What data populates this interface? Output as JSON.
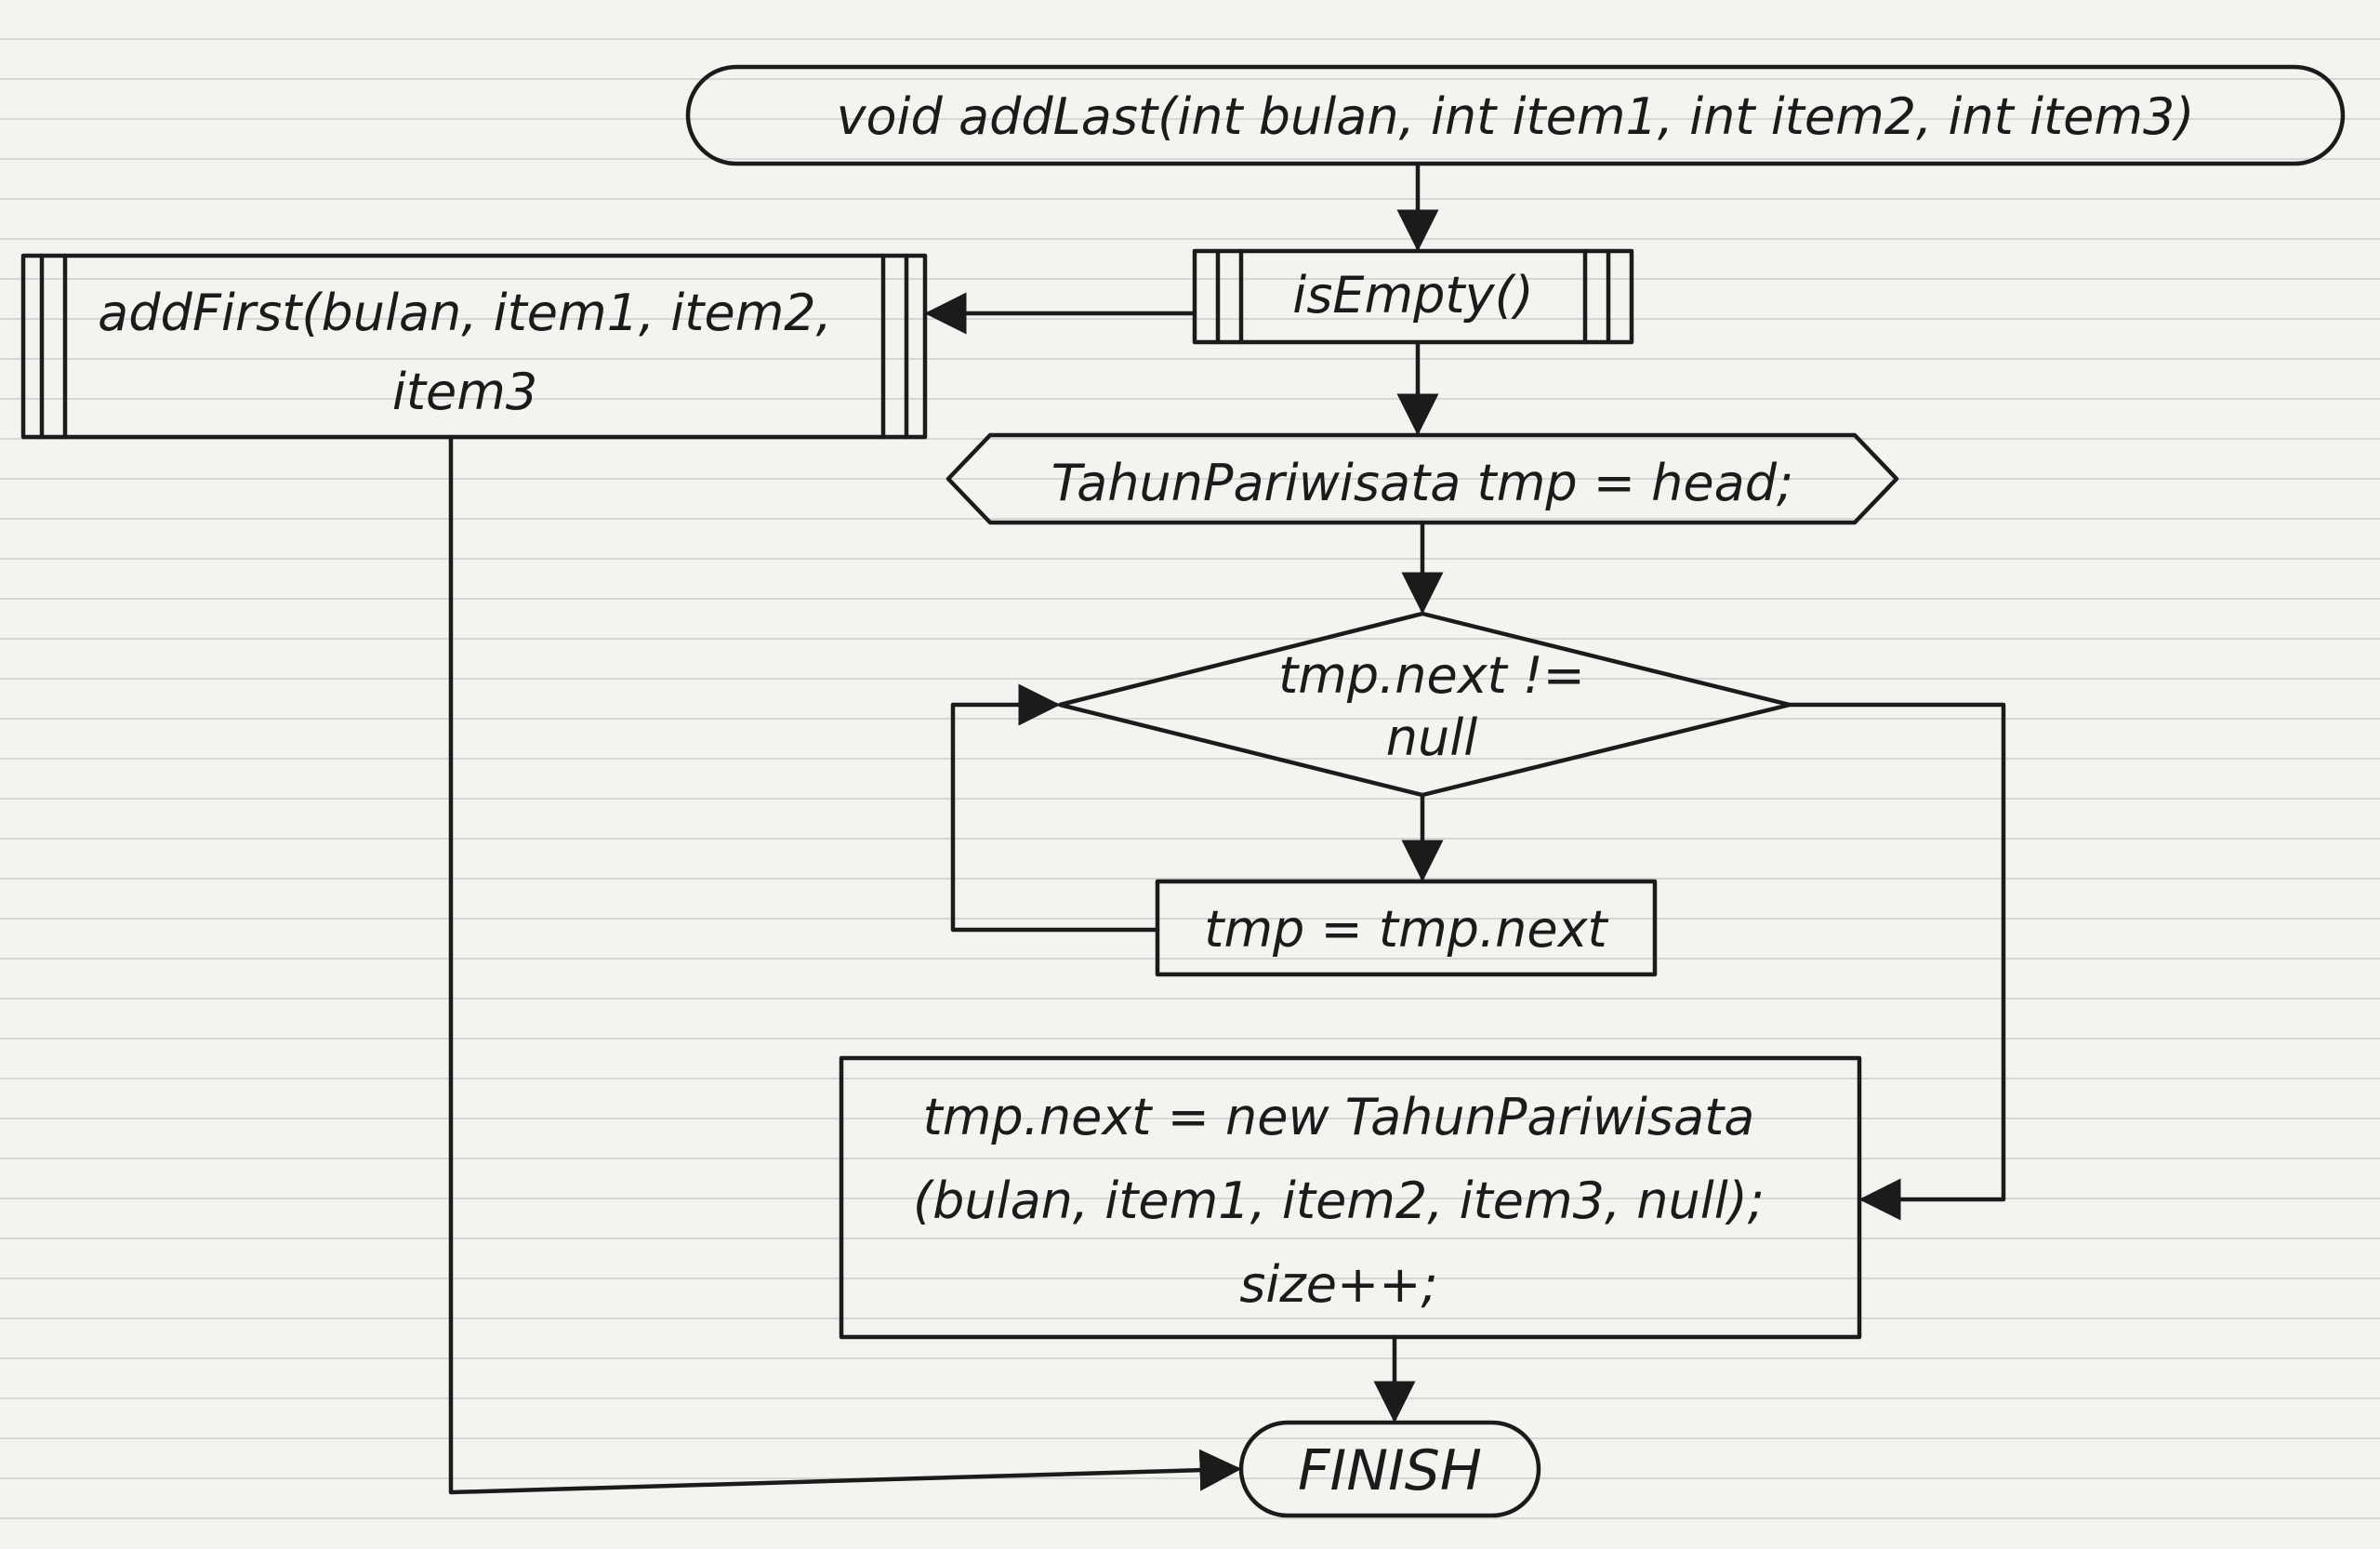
{
  "diagram": {
    "nodes": {
      "start": {
        "text": "void addLast(int bulan, int item1, int item2, int item3)"
      },
      "is_empty": {
        "text": "isEmpty()"
      },
      "add_first": {
        "line1": "addFirst(bulan, item1, item2,",
        "line2": "item3"
      },
      "tmp_assign": {
        "text": "TahunPariwisata tmp = head;"
      },
      "loop_cond": {
        "line1": "tmp.next !=",
        "line2": "null"
      },
      "tmp_advance": {
        "text": "tmp = tmp.next"
      },
      "append": {
        "line1": "tmp.next = new TahunPariwisata",
        "line2": "(bulan, item1, item2, item3, null);",
        "line3": "size++;"
      },
      "finish": {
        "text": "FINISH"
      }
    }
  }
}
